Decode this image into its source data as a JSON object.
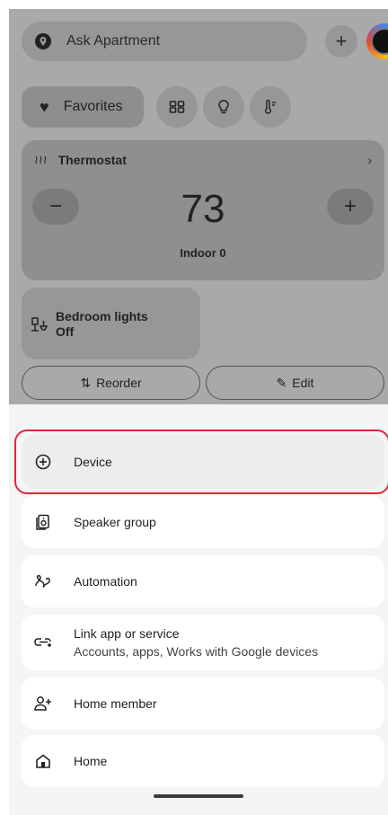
{
  "topbar": {
    "ask_label": "Ask Apartment",
    "plus_label": "+"
  },
  "chips": {
    "favorites_label": "Favorites"
  },
  "thermostat": {
    "title": "Thermostat",
    "temperature": "73",
    "minus_label": "−",
    "plus_label": "+",
    "indoor_label": "Indoor 0",
    "chevron": "›"
  },
  "bedroom": {
    "title": "Bedroom lights",
    "status": "Off"
  },
  "actions": {
    "reorder_label": "Reorder",
    "edit_label": "Edit"
  },
  "sheet": {
    "items": [
      {
        "label": "Device",
        "icon": "add-circle-icon"
      },
      {
        "label": "Speaker group",
        "icon": "speaker-icon"
      },
      {
        "label": "Automation",
        "icon": "automation-icon"
      },
      {
        "label": "Link app or service",
        "sublabel": "Accounts, apps, Works with Google devices",
        "icon": "link-icon"
      },
      {
        "label": "Home member",
        "icon": "person-add-icon"
      },
      {
        "label": "Home",
        "icon": "home-icon"
      }
    ]
  },
  "colors": {
    "highlight": "#e0263c"
  }
}
